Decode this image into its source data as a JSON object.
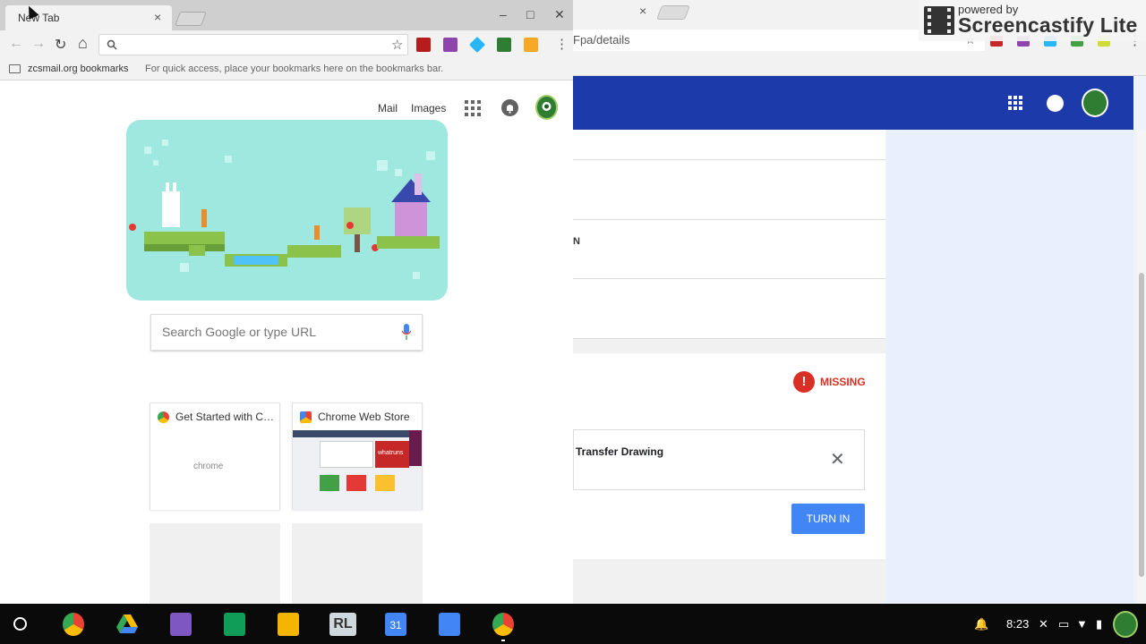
{
  "background_window": {
    "url_fragment": "Fpa/details",
    "item_partial": "N",
    "status": "MISSING",
    "attachment": "Transfer Drawing",
    "turn_in_label": "TURN IN",
    "colors": {
      "appbar": "#1c3aa9",
      "missing": "#d93025",
      "button": "#4285f4"
    }
  },
  "screencastify": {
    "small_text": "powered by",
    "big_text": "Screencastify Lite"
  },
  "browser": {
    "tab_title": "New Tab",
    "tab_close_glyph": "×",
    "window_controls": [
      "–",
      "□",
      "✕"
    ],
    "nav": {
      "back": "←",
      "forward": "→",
      "reload": "↻",
      "home": "⌂"
    },
    "omnibox_icon": "search-icon",
    "omnibox_star": "☆",
    "menu_glyph": "⋮",
    "bookmarks": {
      "folder_name": "zcsmail.org bookmarks",
      "hint": "For quick access, place your bookmarks here on the bookmarks bar."
    }
  },
  "ntp": {
    "mail_link": "Mail",
    "images_link": "Images",
    "search_placeholder": "Search Google or type URL",
    "tiles": [
      {
        "title": "Get Started with Chrome",
        "thumb_text": "chrome"
      },
      {
        "title": "Chrome Web Store",
        "thumb_text": "whatruns"
      }
    ]
  },
  "shelf": {
    "apps": [
      "chrome",
      "drive",
      "forms",
      "sheets",
      "slides",
      "RL",
      "calendar",
      "docs",
      "chrome-active"
    ],
    "calendar_day": "31",
    "rl_label": "RL",
    "clock": "8:23"
  }
}
